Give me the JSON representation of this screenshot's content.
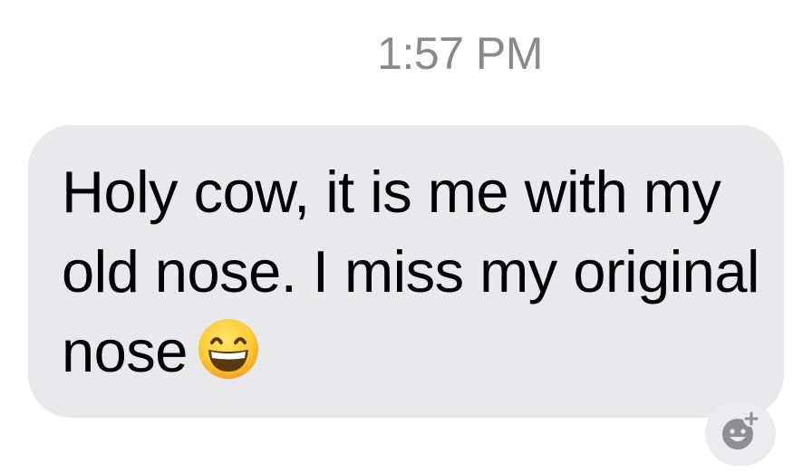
{
  "timestamp": "1:57 PM",
  "message": {
    "text": "Holy cow, it is me with my old nose. I miss my original nose",
    "emoji": "grinning-face-with-smiling-eyes"
  },
  "react_button": {
    "icon": "add-reaction-icon"
  },
  "colors": {
    "bubble": "#e9e9eb",
    "timestamp": "#8a8a8e",
    "text": "#000000"
  }
}
